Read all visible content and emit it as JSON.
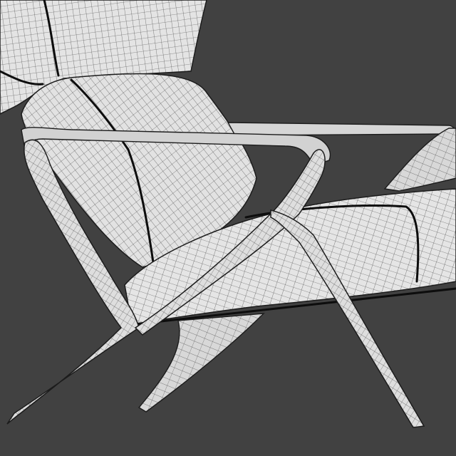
{
  "viewport": {
    "background": "#414141",
    "mesh_fill": "#e6e6e6",
    "wire_color": "#3a3a3a",
    "subject": "wireframe-armchair"
  }
}
